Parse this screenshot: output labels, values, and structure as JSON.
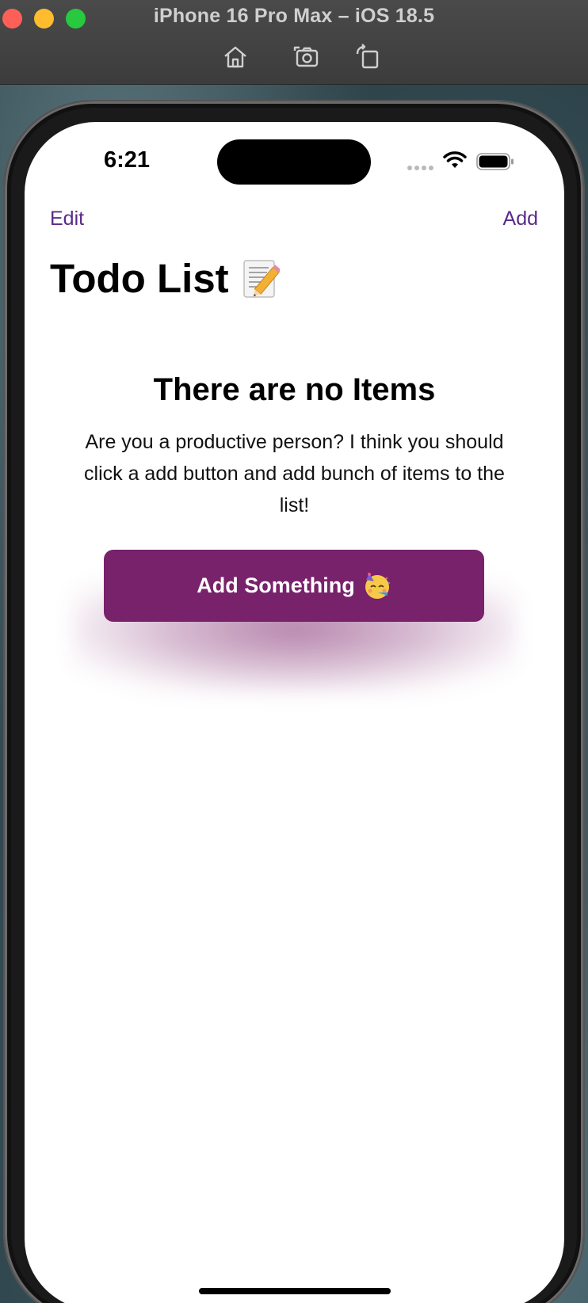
{
  "simulator": {
    "title": "iPhone 16 Pro Max – iOS 18.5",
    "toolbar": [
      "home-icon",
      "screenshot-icon",
      "rotate-icon"
    ]
  },
  "status_bar": {
    "time": "6:21"
  },
  "nav": {
    "edit_label": "Edit",
    "add_label": "Add",
    "title": "Todo List",
    "title_icon": "memo-icon"
  },
  "empty_state": {
    "title": "There are no Items",
    "message": "Are you a productive person? I think you should click a add button and add bunch of items to the list!",
    "button_label": "Add Something",
    "button_icon": "party-face-icon"
  },
  "colors": {
    "accent": "#5a2a8a",
    "button": "#78226b"
  }
}
